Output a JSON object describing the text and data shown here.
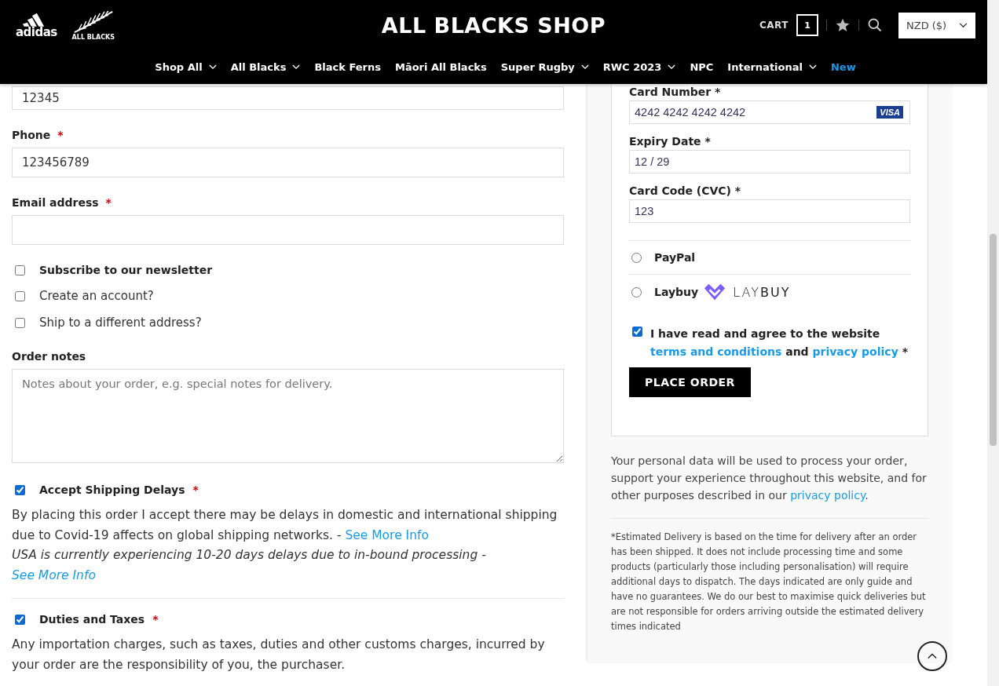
{
  "header": {
    "logos": [
      "adidas",
      "ALL BLACKS"
    ],
    "site_title": "ALL BLACKS SHOP",
    "cart": {
      "label": "CART",
      "count": "1"
    },
    "currency": "NZD ($)",
    "nav": [
      {
        "label": "Shop All",
        "has_dropdown": true,
        "highlighted": false
      },
      {
        "label": "All Blacks",
        "has_dropdown": true,
        "highlighted": false
      },
      {
        "label": "Black Ferns",
        "has_dropdown": false,
        "highlighted": false
      },
      {
        "label": "Māori All Blacks",
        "has_dropdown": false,
        "highlighted": false
      },
      {
        "label": "Super Rugby",
        "has_dropdown": true,
        "highlighted": false
      },
      {
        "label": "RWC 2023",
        "has_dropdown": true,
        "highlighted": false
      },
      {
        "label": "NPC",
        "has_dropdown": false,
        "highlighted": false
      },
      {
        "label": "International",
        "has_dropdown": true,
        "highlighted": false
      },
      {
        "label": "New",
        "has_dropdown": false,
        "highlighted": true
      }
    ]
  },
  "billing": {
    "fields": [
      {
        "value": "12345"
      },
      {
        "label": "Phone",
        "required_mark": "*",
        "value": "123456789"
      },
      {
        "label": "Email address",
        "required_mark": "*"
      }
    ],
    "options": [
      {
        "label": "Subscribe to our newsletter",
        "checked": false,
        "emphasis": true
      },
      {
        "label": "Create an account?",
        "checked": false,
        "emphasis": false
      },
      {
        "label": "Ship to a different address?",
        "checked": false,
        "emphasis": false
      }
    ],
    "order_notes": {
      "label": "Order notes",
      "placeholder": "Notes about your order, e.g. special notes for delivery."
    },
    "agreements": [
      {
        "label": "Accept Shipping Delays",
        "required_mark": "*",
        "checked": true,
        "paragraphs": [
          {
            "text": "By placing this order I accept there may be delays in domestic and international shipping due to Covid-19 affects on global shipping networks. - ",
            "link": "See More Info",
            "italic": false
          },
          {
            "text": "USA is currently experiencing 10-20 days delays due to in-bound processing - ",
            "link": "See More Info",
            "italic": true
          }
        ]
      },
      {
        "label": "Duties and Taxes",
        "required_mark": "*",
        "checked": true,
        "paragraphs": [
          {
            "text": "Any importation charges, such as taxes, duties and other customs charges, incurred by your order are the responsibility of you, the purchaser.",
            "italic": false
          }
        ]
      }
    ]
  },
  "payment": {
    "card_fields": [
      {
        "label": "Card Number *",
        "value": "4242 4242 4242 4242",
        "brand": "VISA"
      },
      {
        "label": "Expiry Date *",
        "value": "12 / 29"
      },
      {
        "label": "Card Code (CVC) *",
        "value": "123"
      }
    ],
    "methods": [
      {
        "name": "PayPal",
        "selected": false
      },
      {
        "name": "Laybuy",
        "selected": false,
        "logo": "LAY**BUY**"
      }
    ],
    "terms": {
      "checked": true,
      "parts": [
        {
          "text": "I have read and agree to the website "
        },
        {
          "text": "terms and conditions",
          "link": true
        },
        {
          "text": " and "
        },
        {
          "text": "privacy policy",
          "link": true
        },
        {
          "text": " *"
        }
      ]
    },
    "button": "PLACE ORDER"
  },
  "privacy_note": {
    "text": "Your personal data will be used to process your order, support your experience throughout this website, and for other purposes described in our ",
    "link": "privacy policy",
    "end": "."
  },
  "delivery_note": "*Estimated Delivery is based on the time for delivery after an order has been shipped. It does not include processing time and some products (particularly those including personalisation) will require additional days to dispatch. The days indicated are only guide and have no guarantees. We do our best to maximise quick deliveries but are not responsible for orders arriving outside the estimated delivery times indicated"
}
